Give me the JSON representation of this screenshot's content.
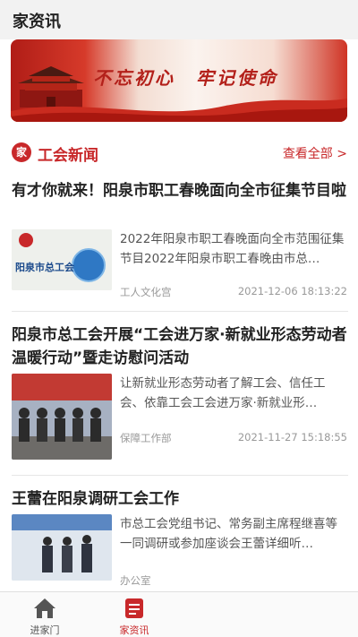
{
  "header": {
    "title": "家资讯"
  },
  "banner": {
    "slogan": "不忘初心　牢记使命"
  },
  "section": {
    "icon_char": "家",
    "title": "工会新闻",
    "more": "查看全部 >"
  },
  "news": [
    {
      "title": "有才你就来！阳泉市职工春晚面向全市征集节目啦",
      "summary": "2022年阳泉市职工春晚面向全市范围征集节目2022年阳泉市职工春晚由市总…",
      "source": "工人文化宫",
      "time": "2021-12-06 18:13:22",
      "thumb_text": "阳泉市总工会"
    },
    {
      "title": "阳泉市总工会开展“工会进万家·新就业形态劳动者温暖行动”暨走访慰问活动",
      "summary": "让新就业形态劳动者了解工会、信任工会、依靠工会工会进万家·新就业形…",
      "source": "保障工作部",
      "time": "2021-11-27 15:18:55"
    },
    {
      "title": "王蕾在阳泉调研工会工作",
      "summary": "市总工会党组书记、常务副主席程继喜等一同调研或参加座谈会王蕾详细听…",
      "source": "办公室",
      "time": ""
    }
  ],
  "tabbar": {
    "items": [
      {
        "label": "进家门",
        "icon": "home-icon",
        "active": false
      },
      {
        "label": "家资讯",
        "icon": "news-icon",
        "active": true
      }
    ]
  },
  "colors": {
    "accent": "#c8282a",
    "inactive_tab": "#555555"
  }
}
